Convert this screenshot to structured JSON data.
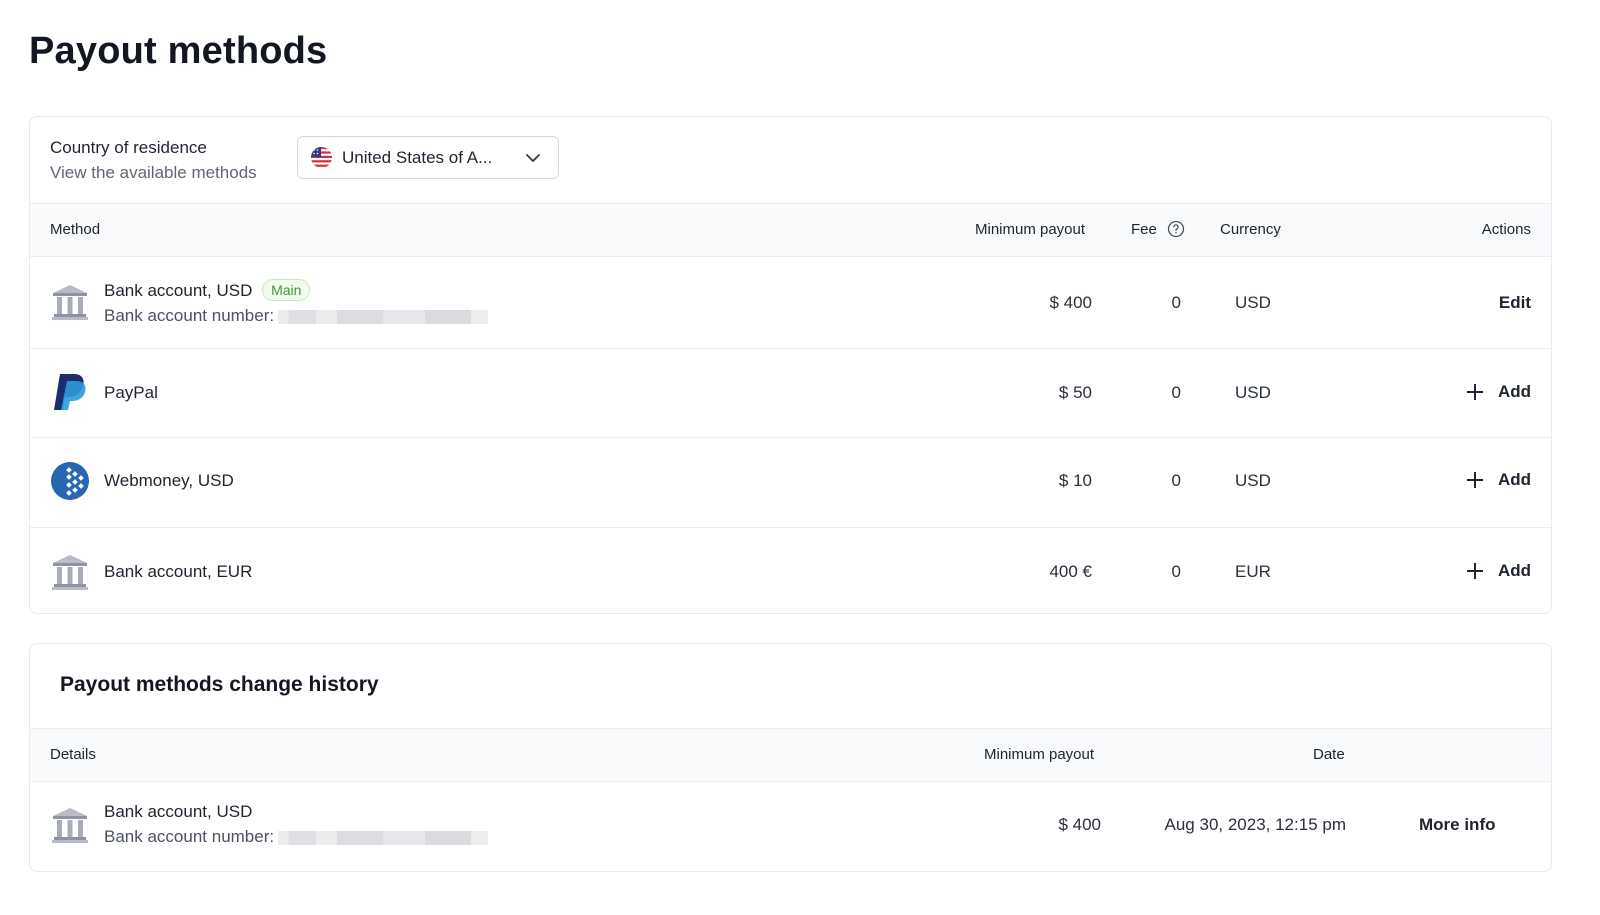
{
  "page": {
    "title": "Payout methods"
  },
  "country": {
    "label": "Country of residence",
    "sublabel": "View the available methods",
    "selected": "United States of A..."
  },
  "methods_table": {
    "headers": {
      "method": "Method",
      "minimum_payout": "Minimum payout",
      "fee": "Fee",
      "currency": "Currency",
      "actions": "Actions"
    },
    "rows": [
      {
        "icon": "bank-icon",
        "name": "Bank account, USD",
        "badge": "Main",
        "sub": "Bank account number:",
        "min_payout": "$ 400",
        "fee": "0",
        "currency": "USD",
        "action": "Edit"
      },
      {
        "icon": "paypal-icon",
        "name": "PayPal",
        "min_payout": "$ 50",
        "fee": "0",
        "currency": "USD",
        "action": "Add"
      },
      {
        "icon": "webmoney-icon",
        "name": "Webmoney, USD",
        "min_payout": "$ 10",
        "fee": "0",
        "currency": "USD",
        "action": "Add"
      },
      {
        "icon": "bank-icon",
        "name": "Bank account, EUR",
        "min_payout": "400 €",
        "fee": "0",
        "currency": "EUR",
        "action": "Add"
      }
    ]
  },
  "history": {
    "title": "Payout methods change history",
    "headers": {
      "details": "Details",
      "minimum_payout": "Minimum payout",
      "date": "Date"
    },
    "rows": [
      {
        "icon": "bank-icon",
        "name": "Bank account, USD",
        "sub": "Bank account number:",
        "min_payout": "$ 400",
        "date": "Aug 30, 2023, 12:15 pm",
        "action": "More info"
      }
    ]
  }
}
